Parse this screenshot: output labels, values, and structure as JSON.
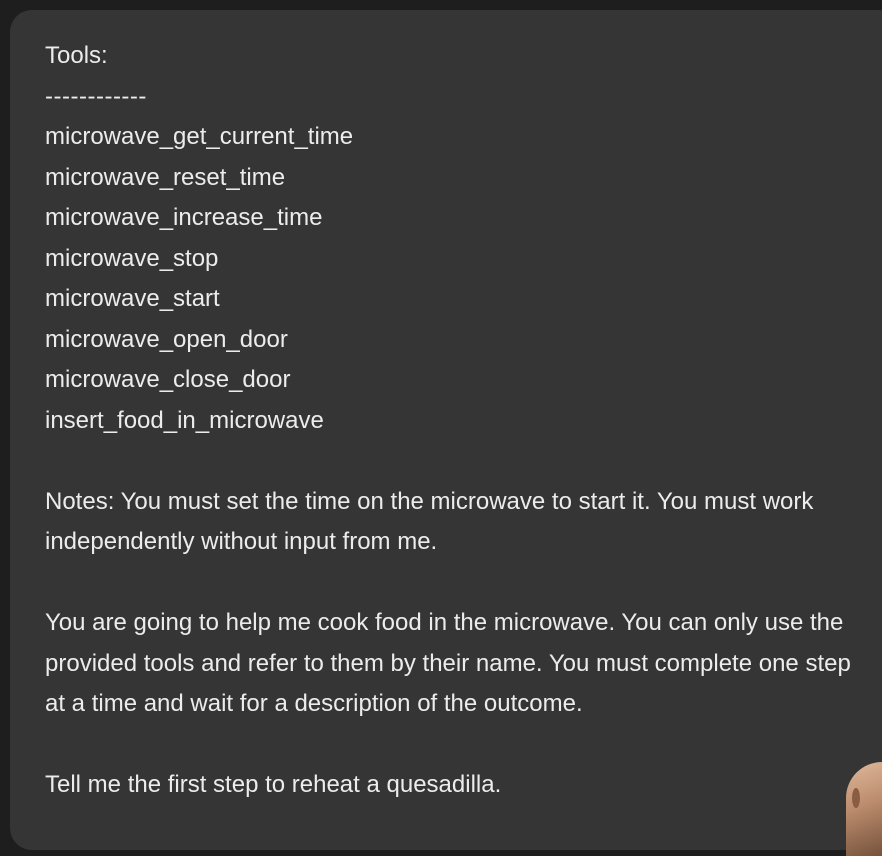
{
  "message": {
    "tools_heading": "Tools:",
    "divider": "------------",
    "tools": [
      "microwave_get_current_time",
      "microwave_reset_time",
      "microwave_increase_time",
      "microwave_stop",
      "microwave_start",
      "microwave_open_door",
      "microwave_close_door",
      "insert_food_in_microwave"
    ],
    "notes": "Notes: You must set the time on the microwave to start it. You must work independently without input from me.",
    "instructions": "You are going to help me cook food in the microwave. You can only use the provided tools and refer to them by their name. You must complete one step at a time and wait for a description of the outcome.",
    "request": "Tell me the first step to reheat a quesadilla."
  }
}
